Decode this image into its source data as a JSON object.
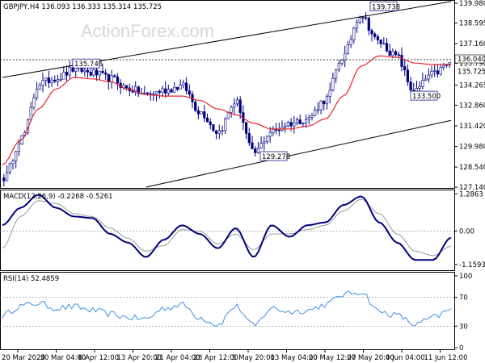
{
  "main": {
    "header": "GBPJPY,H4  136.093 136.333 135.314 135.725",
    "watermark": "ActionForex.com",
    "yaxis_ticks": [
      "139.980",
      "138.595",
      "137.160",
      "135.790",
      "134.265",
      "132.860",
      "131.420",
      "129.980",
      "128.540",
      "127.140"
    ],
    "last_price": "136.040",
    "ma_value": "135.725",
    "annotations": [
      {
        "text": "135.746",
        "value": 135.746
      },
      {
        "text": "139.738",
        "value": 139.738
      },
      {
        "text": "129.278",
        "value": 129.278
      },
      {
        "text": "133.500",
        "value": 133.5
      }
    ]
  },
  "macd": {
    "header": "MACD(12,26,9) -0.2268 -0.5261",
    "yaxis_ticks": [
      "1.2863",
      "0.00",
      "-1.1593"
    ]
  },
  "rsi": {
    "header": "RSI(14) 52.4859",
    "yaxis_ticks": [
      "100",
      "70",
      "30",
      "0"
    ]
  },
  "xaxis_labels": [
    "20 Mar 2020",
    "30 Mar 04:00",
    "6 Apr 12:00",
    "13 Apr 20:00",
    "21 Apr 04:00",
    "28 Apr 12:00",
    "5 May 20:00",
    "13 May 04:00",
    "20 May 12:00",
    "27 May 20:00",
    "4 Jun 04:00",
    "11 Jun 12:00"
  ],
  "colors": {
    "candle": "#000080",
    "ma": "#e8262d",
    "macd": "#000080",
    "signal": "#999999",
    "rsi": "#3d8fe0",
    "channel": "#000000"
  },
  "chart_data": [
    {
      "type": "line",
      "title": "GBPJPY,H4  136.093 136.333 135.314 135.725",
      "xlabel": "",
      "ylabel": "",
      "ylim": [
        127.14,
        139.98
      ],
      "series": [
        {
          "kind": "candlestick-close",
          "x": [
            "20 Mar 2020",
            "24 Mar",
            "30 Mar 04:00",
            "3 Apr",
            "6 Apr 12:00",
            "10 Apr",
            "13 Apr 20:00",
            "17 Apr",
            "21 Apr 04:00",
            "24 Apr",
            "28 Apr 12:00",
            "1 May",
            "5 May 20:00",
            "9 May",
            "13 May 04:00",
            "16 May",
            "20 May 12:00",
            "24 May",
            "27 May 20:00",
            "1 Jun",
            "4 Jun 04:00",
            "6 Jun",
            "8 Jun",
            "10 Jun",
            "11 Jun 12:00",
            "12 Jun"
          ],
          "values": [
            127.8,
            130.6,
            134.4,
            134.8,
            135.4,
            135.1,
            134.7,
            134.0,
            133.6,
            133.9,
            134.2,
            132.4,
            131.0,
            133.1,
            129.5,
            131.0,
            131.6,
            131.9,
            133.2,
            136.2,
            139.2,
            137.3,
            136.3,
            133.8,
            135.0,
            135.725
          ]
        },
        {
          "name": "MA",
          "x": [
            "20 Mar 2020",
            "24 Mar",
            "30 Mar 04:00",
            "3 Apr",
            "6 Apr 12:00",
            "10 Apr",
            "13 Apr 20:00",
            "17 Apr",
            "21 Apr 04:00",
            "24 Apr",
            "28 Apr 12:00",
            "1 May",
            "5 May 20:00",
            "9 May",
            "13 May 04:00",
            "16 May",
            "20 May 12:00",
            "24 May",
            "27 May 20:00",
            "1 Jun",
            "4 Jun 04:00",
            "6 Jun",
            "8 Jun",
            "10 Jun",
            "11 Jun 12:00",
            "12 Jun"
          ],
          "values": [
            128.7,
            130.4,
            132.6,
            134.0,
            134.8,
            134.7,
            134.5,
            134.0,
            133.6,
            133.5,
            133.5,
            133.2,
            132.6,
            132.2,
            131.6,
            131.2,
            131.2,
            131.4,
            131.9,
            133.5,
            135.6,
            136.3,
            136.2,
            135.8,
            135.7,
            135.725
          ]
        }
      ],
      "channel_lines": [
        {
          "from": [
            "20 Mar 2020",
            134.8
          ],
          "to": [
            "12 Jun",
            140.1
          ]
        },
        {
          "from": [
            "21 Apr 04:00",
            127.14
          ],
          "to": [
            "12 Jun",
            131.8
          ]
        }
      ]
    },
    {
      "type": "line",
      "title": "MACD(12,26,9) -0.2268 -0.5261",
      "ylim": [
        -1.3,
        1.35
      ],
      "series": [
        {
          "name": "MACD",
          "x": [
            "20 Mar 2020",
            "24 Mar",
            "30 Mar 04:00",
            "3 Apr",
            "6 Apr 12:00",
            "10 Apr",
            "13 Apr 20:00",
            "17 Apr",
            "21 Apr 04:00",
            "24 Apr",
            "28 Apr 12:00",
            "1 May",
            "5 May 20:00",
            "9 May",
            "13 May 04:00",
            "16 May",
            "20 May 12:00",
            "24 May",
            "27 May 20:00",
            "1 Jun",
            "4 Jun 04:00",
            "6 Jun",
            "8 Jun",
            "10 Jun",
            "11 Jun 12:00",
            "12 Jun"
          ],
          "values": [
            0.2,
            0.8,
            1.25,
            0.8,
            0.5,
            0.45,
            -0.1,
            -0.4,
            -0.9,
            -0.3,
            0.2,
            -0.1,
            -0.6,
            0.1,
            -0.9,
            0.2,
            -0.2,
            0.2,
            0.3,
            0.9,
            1.2,
            0.3,
            -0.4,
            -1.0,
            -1.0,
            -0.2268
          ]
        },
        {
          "name": "Signal",
          "x": [
            "20 Mar 2020",
            "24 Mar",
            "30 Mar 04:00",
            "3 Apr",
            "6 Apr 12:00",
            "10 Apr",
            "13 Apr 20:00",
            "17 Apr",
            "21 Apr 04:00",
            "24 Apr",
            "28 Apr 12:00",
            "1 May",
            "5 May 20:00",
            "9 May",
            "13 May 04:00",
            "16 May",
            "20 May 12:00",
            "24 May",
            "27 May 20:00",
            "1 Jun",
            "4 Jun 04:00",
            "6 Jun",
            "8 Jun",
            "10 Jun",
            "11 Jun 12:00",
            "12 Jun"
          ],
          "values": [
            -0.6,
            0.5,
            1.05,
            0.95,
            0.6,
            0.5,
            0.1,
            -0.25,
            -0.7,
            -0.5,
            0.05,
            0.0,
            -0.45,
            -0.1,
            -0.65,
            -0.1,
            -0.1,
            0.05,
            0.2,
            0.7,
            1.1,
            0.6,
            -0.1,
            -0.7,
            -0.85,
            -0.5261
          ]
        }
      ]
    },
    {
      "type": "line",
      "title": "RSI(14) 52.4859",
      "ylim": [
        0,
        100
      ],
      "series": [
        {
          "name": "RSI",
          "x": [
            "20 Mar 2020",
            "24 Mar",
            "30 Mar 04:00",
            "3 Apr",
            "6 Apr 12:00",
            "10 Apr",
            "13 Apr 20:00",
            "17 Apr",
            "21 Apr 04:00",
            "24 Apr",
            "28 Apr 12:00",
            "1 May",
            "5 May 20:00",
            "9 May",
            "13 May 04:00",
            "16 May",
            "20 May 12:00",
            "24 May",
            "27 May 20:00",
            "1 Jun",
            "4 Jun 04:00",
            "6 Jun",
            "8 Jun",
            "10 Jun",
            "11 Jun 12:00",
            "12 Jun"
          ],
          "values": [
            45,
            58,
            62,
            55,
            57,
            52,
            47,
            42,
            40,
            55,
            60,
            42,
            32,
            58,
            30,
            55,
            50,
            52,
            60,
            74,
            78,
            50,
            45,
            32,
            42,
            52.4859
          ]
        }
      ],
      "levels": [
        70,
        30
      ]
    }
  ]
}
